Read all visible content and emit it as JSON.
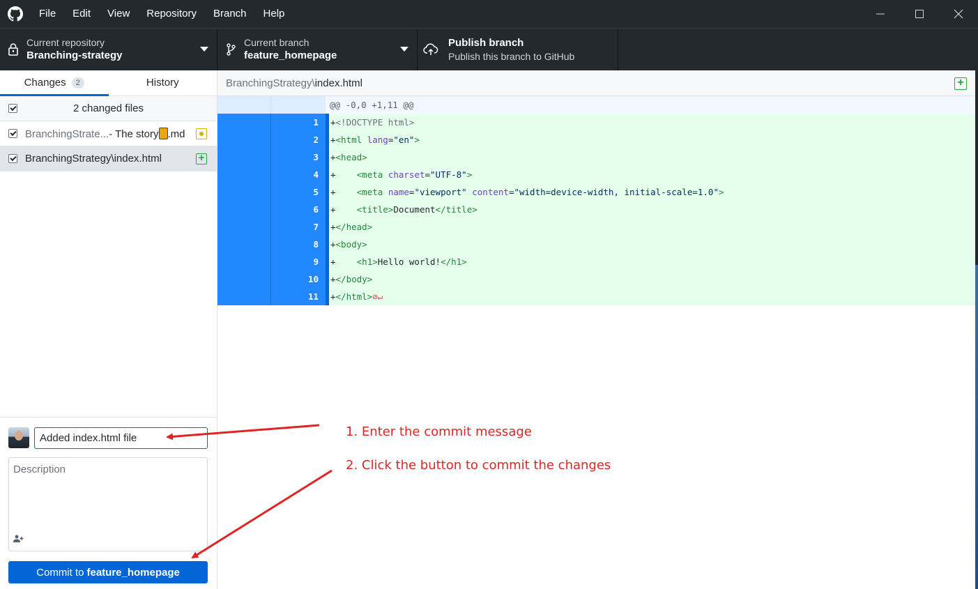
{
  "menu": [
    "File",
    "Edit",
    "View",
    "Repository",
    "Branch",
    "Help"
  ],
  "toolbar": {
    "repo_label": "Current repository",
    "repo_value": "Branching-strategy",
    "branch_label": "Current branch",
    "branch_value": "feature_homepage",
    "publish_title": "Publish branch",
    "publish_subtitle": "Publish this branch to GitHub"
  },
  "tabs": {
    "changes": "Changes",
    "changes_count": "2",
    "history": "History"
  },
  "changes": {
    "header": "2 changed files",
    "files": [
      {
        "dim": "BranchingStrate...",
        "name": "- The story",
        "suffix": ".md",
        "status": "modified"
      },
      {
        "name": "BranchingStrategy\\index.html",
        "status": "added"
      }
    ]
  },
  "commit": {
    "summary": "Added index.html file",
    "description_placeholder": "Description",
    "button_prefix": "Commit to",
    "button_branch": "feature_homepage"
  },
  "diff": {
    "path_dir": "BranchingStrategy\\",
    "path_file": "index.html",
    "hunk": "@@ -0,0 +1,11 @@",
    "line_numbers": [
      "1",
      "2",
      "3",
      "4",
      "5",
      "6",
      "7",
      "8",
      "9",
      "10",
      "11"
    ]
  },
  "annotations": {
    "step1": "1. Enter the commit message",
    "step2": "2. Click the button to commit the changes"
  },
  "colors": {
    "accent": "#0366d6",
    "annotation": "#e02424",
    "added_bg": "#e6ffed"
  }
}
